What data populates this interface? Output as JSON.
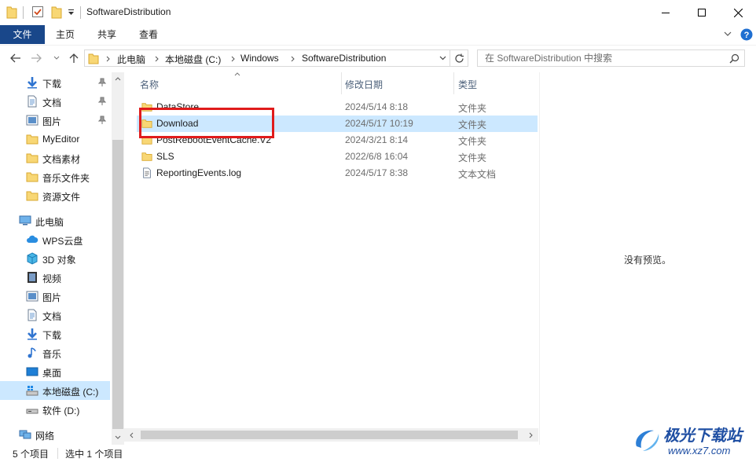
{
  "window": {
    "title": "SoftwareDistribution",
    "minimize_icon": "minimize-icon",
    "maximize_icon": "maximize-icon",
    "close_icon": "close-icon"
  },
  "ribbon": {
    "tabs": [
      {
        "label": "文件",
        "active": true
      },
      {
        "label": "主页",
        "active": false
      },
      {
        "label": "共享",
        "active": false
      },
      {
        "label": "查看",
        "active": false
      }
    ]
  },
  "address": {
    "breadcrumbs": [
      "此电脑",
      "本地磁盘 (C:)",
      "Windows",
      "SoftwareDistribution"
    ],
    "search_placeholder": "在 SoftwareDistribution 中搜索"
  },
  "nav": {
    "quick_access": [
      {
        "label": "下载",
        "icon": "download-arrow-icon",
        "pinned": true
      },
      {
        "label": "文档",
        "icon": "document-icon",
        "pinned": true
      },
      {
        "label": "图片",
        "icon": "picture-icon",
        "pinned": true
      },
      {
        "label": "MyEditor",
        "icon": "folder-icon",
        "pinned": false
      },
      {
        "label": "文档素材",
        "icon": "folder-icon",
        "pinned": false
      },
      {
        "label": "音乐文件夹",
        "icon": "folder-icon",
        "pinned": false
      },
      {
        "label": "资源文件",
        "icon": "folder-icon",
        "pinned": false
      }
    ],
    "this_pc": {
      "label": "此电脑",
      "icon": "computer-icon"
    },
    "pc_items": [
      {
        "label": "WPS云盘",
        "icon": "cloud-icon"
      },
      {
        "label": "3D 对象",
        "icon": "cube-icon"
      },
      {
        "label": "视频",
        "icon": "film-icon"
      },
      {
        "label": "图片",
        "icon": "picture-icon"
      },
      {
        "label": "文档",
        "icon": "document-icon"
      },
      {
        "label": "下载",
        "icon": "download-arrow-icon"
      },
      {
        "label": "音乐",
        "icon": "music-note-icon"
      },
      {
        "label": "桌面",
        "icon": "desktop-icon"
      },
      {
        "label": "本地磁盘 (C:)",
        "icon": "windows-drive-icon",
        "selected": true
      },
      {
        "label": "软件 (D:)",
        "icon": "drive-icon"
      }
    ],
    "network": {
      "label": "网络",
      "icon": "network-icon"
    }
  },
  "filelist": {
    "columns": {
      "name": "名称",
      "date": "修改日期",
      "type": "类型"
    },
    "rows": [
      {
        "name": "DataStore",
        "date": "2024/5/14 8:18",
        "type": "文件夹",
        "icon": "folder-icon",
        "selected": false
      },
      {
        "name": "Download",
        "date": "2024/5/17 10:19",
        "type": "文件夹",
        "icon": "folder-icon",
        "selected": true
      },
      {
        "name": "PostRebootEventCache.V2",
        "date": "2024/3/21 8:14",
        "type": "文件夹",
        "icon": "folder-icon",
        "selected": false
      },
      {
        "name": "SLS",
        "date": "2022/6/8 16:04",
        "type": "文件夹",
        "icon": "folder-icon",
        "selected": false
      },
      {
        "name": "ReportingEvents.log",
        "date": "2024/5/17 8:38",
        "type": "文本文档",
        "icon": "text-file-icon",
        "selected": false
      }
    ]
  },
  "preview": {
    "text": "没有预览。"
  },
  "status": {
    "item_count": "5 个项目",
    "selected": "选中 1 个项目"
  },
  "watermark": {
    "text": "极光下载站",
    "url": "www.xz7.com"
  },
  "colors": {
    "accent": "#19478a",
    "selection": "#cce8ff",
    "highlight": "#e01b1b",
    "folder": "#f8d775"
  }
}
